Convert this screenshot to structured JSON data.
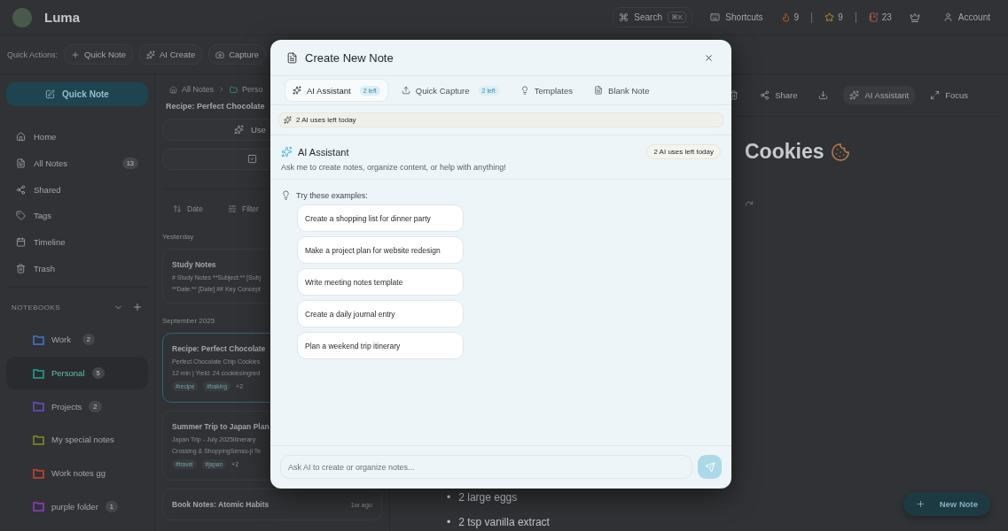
{
  "app": {
    "name": "Luma"
  },
  "header": {
    "search": {
      "label": "Search",
      "shortcut": "⌘K"
    },
    "shortcuts": "Shortcuts",
    "stats": [
      "9",
      "9",
      "23"
    ],
    "account": "Account"
  },
  "quick_actions": {
    "label": "Quick Actions:",
    "buttons": [
      "Quick Note",
      "AI Create",
      "Capture"
    ]
  },
  "sidebar": {
    "primary_button": "Quick Note",
    "items": [
      {
        "label": "Home"
      },
      {
        "label": "All Notes",
        "count": "13"
      },
      {
        "label": "Shared"
      },
      {
        "label": "Tags"
      },
      {
        "label": "Timeline"
      },
      {
        "label": "Trash"
      }
    ],
    "notebooks_heading": "NOTEBOOKS",
    "notebooks": [
      {
        "label": "Work",
        "count": "2",
        "color": "#3d66a8",
        "selected": false
      },
      {
        "label": "Personal",
        "count": "5",
        "color": "#1f8a7c",
        "selected": true
      },
      {
        "label": "Projects",
        "count": "2",
        "color": "#5e45a6",
        "selected": false
      },
      {
        "label": "My special notes",
        "color": "#6f7a1e",
        "selected": false
      },
      {
        "label": "Work notes gg",
        "color": "#a8402f",
        "selected": false
      },
      {
        "label": "purple folder",
        "count": "1",
        "color": "#7a3aa8",
        "selected": false
      }
    ]
  },
  "note_list": {
    "breadcrumb": [
      "All Notes",
      "Perso"
    ],
    "title": "Recipe: Perfect Chocolate",
    "action": "Use",
    "sort": "Date",
    "filter": "Filter",
    "groups": [
      {
        "label": "Yesterday",
        "notes": [
          {
            "title": "Study Notes",
            "preview": [
              "# Study Notes **Subject:** [Subj",
              "**Date:** [Date] ## Key Concept"
            ],
            "selected": false
          }
        ]
      },
      {
        "label": "September 2025",
        "notes": [
          {
            "title": "Recipe: Perfect Chocolate",
            "preview": [
              "Perfect Chocolate Chip Cookies",
              "12 min | Yield: 24 cookiesIngred"
            ],
            "tags": [
              "#recipe",
              "#baking"
            ],
            "more": "+2",
            "selected": true
          },
          {
            "title": "Summer Trip to Japan Plan",
            "preview": [
              "Japan Trip - July 2025Itinerary",
              "Crossing & ShoppingSenso-ji Te"
            ],
            "tags": [
              "#travel",
              "#japan"
            ],
            "more": "+2",
            "selected": false
          },
          {
            "title": "Book Notes: Atomic Habits",
            "time": "1w ago",
            "selected": false
          }
        ]
      }
    ]
  },
  "editor": {
    "toolbar": [
      "Share",
      "AI Assistant",
      "Focus"
    ],
    "title": "Cookies",
    "marker": "•",
    "bullets": [
      "2 large eggs",
      "2 tsp vanilla extract"
    ],
    "fab": "New Note"
  },
  "modal": {
    "title": "Create New Note",
    "tabs": [
      {
        "label": "AI Assistant",
        "badge": "2 left",
        "selected": true
      },
      {
        "label": "Quick Capture",
        "badge": "2 left",
        "selected": false
      },
      {
        "label": "Templates",
        "selected": false
      },
      {
        "label": "Blank Note",
        "selected": false
      }
    ],
    "banner": "2 AI uses left today",
    "assistant": {
      "title": "AI Assistant",
      "badge": "2 AI uses left today",
      "subtitle": "Ask me to create notes, organize content, or help with anything!"
    },
    "examples_heading": "Try these examples:",
    "examples": [
      "Create a shopping list for dinner party",
      "Make a project plan for website redesign",
      "Write meeting notes template",
      "Create a daily journal entry",
      "Plan a weekend trip itinerary"
    ],
    "input": {
      "placeholder": "Ask AI to create or organize notes..."
    }
  }
}
